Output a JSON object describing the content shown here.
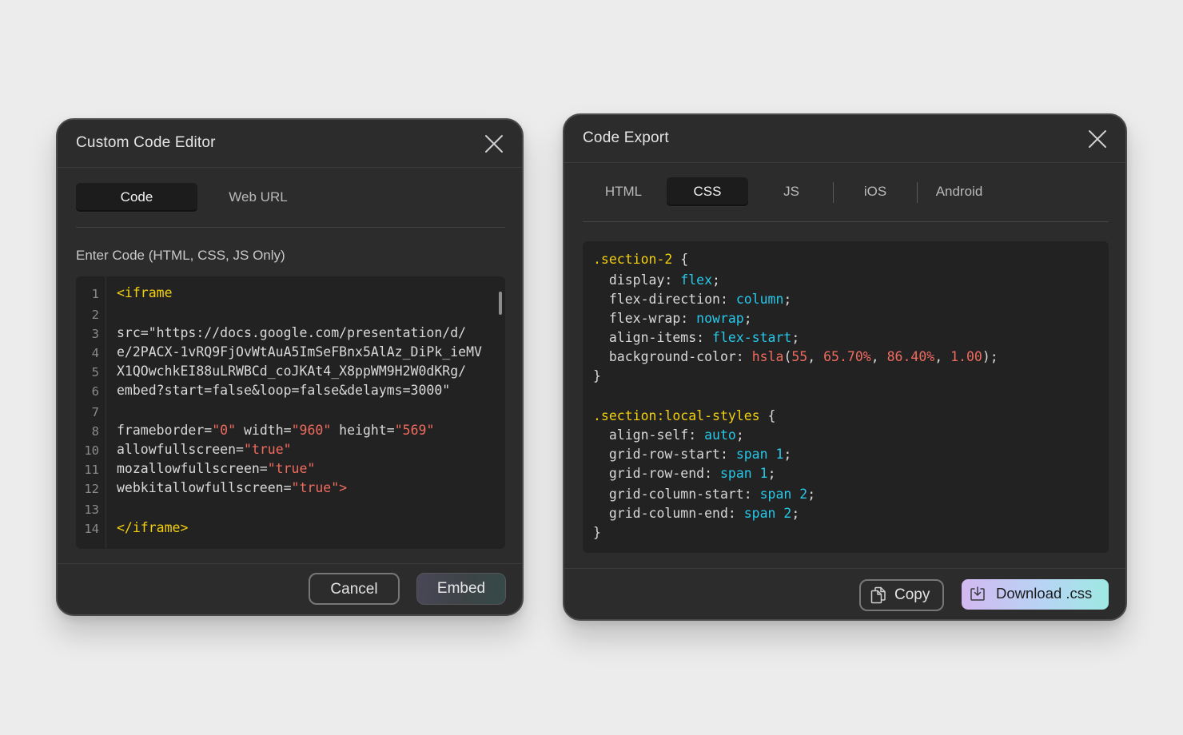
{
  "editor": {
    "title": "Custom Code Editor",
    "tabs": [
      {
        "label": "Code",
        "active": true
      },
      {
        "label": "Web URL",
        "active": false
      }
    ],
    "field_label": "Enter Code (HTML, CSS, JS Only)",
    "line_numbers": [
      "1",
      "2",
      "3",
      "4",
      "5",
      "6",
      "7",
      "8",
      "10",
      "11",
      "12",
      "13",
      "14"
    ],
    "code_lines": [
      {
        "tokens": [
          {
            "t": "<iframe",
            "c": "tag"
          }
        ]
      },
      {
        "tokens": []
      },
      {
        "tokens": [
          {
            "t": "src=\"https://docs.google.com/presentation/d/",
            "c": "txt"
          }
        ]
      },
      {
        "tokens": [
          {
            "t": "e/2PACX-1vRQ9FjOvWtAuA5ImSeFBnx5AlAz_DiPk_ieMV",
            "c": "txt"
          }
        ]
      },
      {
        "tokens": [
          {
            "t": "X1QOwchkEI88uLRWBCd_coJKAt4_X8ppWM9H2W0dKRg/",
            "c": "txt"
          }
        ]
      },
      {
        "tokens": [
          {
            "t": "embed?start=false&loop=false&delayms=3000\"",
            "c": "txt"
          }
        ]
      },
      {
        "tokens": []
      },
      {
        "tokens": [
          {
            "t": "frameborder=",
            "c": "txt"
          },
          {
            "t": "\"0\"",
            "c": "str"
          },
          {
            "t": " width=",
            "c": "txt"
          },
          {
            "t": "\"960\"",
            "c": "str"
          },
          {
            "t": " height=",
            "c": "txt"
          },
          {
            "t": "\"569\"",
            "c": "str"
          }
        ]
      },
      {
        "tokens": [
          {
            "t": "allowfullscreen=",
            "c": "txt"
          },
          {
            "t": "\"true\"",
            "c": "str"
          }
        ]
      },
      {
        "tokens": [
          {
            "t": "mozallowfullscreen=",
            "c": "txt"
          },
          {
            "t": "\"true\"",
            "c": "str"
          }
        ]
      },
      {
        "tokens": [
          {
            "t": "webkitallowfullscreen=",
            "c": "txt"
          },
          {
            "t": "\"true\">",
            "c": "str"
          }
        ]
      },
      {
        "tokens": []
      },
      {
        "tokens": [
          {
            "t": "</iframe>",
            "c": "tag"
          }
        ]
      }
    ],
    "cancel_label": "Cancel",
    "embed_label": "Embed"
  },
  "export": {
    "title": "Code Export",
    "tabs": [
      {
        "label": "HTML",
        "active": false
      },
      {
        "label": "CSS",
        "active": true
      },
      {
        "label": "JS",
        "active": false
      },
      {
        "label": "iOS",
        "active": false
      },
      {
        "label": "Android",
        "active": false
      }
    ],
    "code_lines": [
      {
        "tokens": [
          {
            "t": ".section-2",
            "c": "sel"
          },
          {
            "t": " {",
            "c": "txt"
          }
        ]
      },
      {
        "tokens": [
          {
            "t": "  display: ",
            "c": "txt"
          },
          {
            "t": "flex",
            "c": "val"
          },
          {
            "t": ";",
            "c": "txt"
          }
        ]
      },
      {
        "tokens": [
          {
            "t": "  flex-direction: ",
            "c": "txt"
          },
          {
            "t": "column",
            "c": "val"
          },
          {
            "t": ";",
            "c": "txt"
          }
        ]
      },
      {
        "tokens": [
          {
            "t": "  flex-wrap: ",
            "c": "txt"
          },
          {
            "t": "nowrap",
            "c": "val"
          },
          {
            "t": ";",
            "c": "txt"
          }
        ]
      },
      {
        "tokens": [
          {
            "t": "  align-items: ",
            "c": "txt"
          },
          {
            "t": "flex-start",
            "c": "val"
          },
          {
            "t": ";",
            "c": "txt"
          }
        ]
      },
      {
        "tokens": [
          {
            "t": "  background-color: ",
            "c": "txt"
          },
          {
            "t": "hsla",
            "c": "num"
          },
          {
            "t": "(",
            "c": "txt"
          },
          {
            "t": "55",
            "c": "num"
          },
          {
            "t": ", ",
            "c": "txt"
          },
          {
            "t": "65.70%",
            "c": "num"
          },
          {
            "t": ", ",
            "c": "txt"
          },
          {
            "t": "86.40%",
            "c": "num"
          },
          {
            "t": ", ",
            "c": "txt"
          },
          {
            "t": "1.00",
            "c": "num"
          },
          {
            "t": ");",
            "c": "txt"
          }
        ]
      },
      {
        "tokens": [
          {
            "t": "}",
            "c": "txt"
          }
        ]
      },
      {
        "tokens": []
      },
      {
        "tokens": [
          {
            "t": ".section:local-styles",
            "c": "sel"
          },
          {
            "t": " {",
            "c": "txt"
          }
        ]
      },
      {
        "tokens": [
          {
            "t": "  align-self: ",
            "c": "txt"
          },
          {
            "t": "auto",
            "c": "val"
          },
          {
            "t": ";",
            "c": "txt"
          }
        ]
      },
      {
        "tokens": [
          {
            "t": "  grid-row-start: ",
            "c": "txt"
          },
          {
            "t": "span 1",
            "c": "val"
          },
          {
            "t": ";",
            "c": "txt"
          }
        ]
      },
      {
        "tokens": [
          {
            "t": "  grid-row-end: ",
            "c": "txt"
          },
          {
            "t": "span 1",
            "c": "val"
          },
          {
            "t": ";",
            "c": "txt"
          }
        ]
      },
      {
        "tokens": [
          {
            "t": "  grid-column-start: ",
            "c": "txt"
          },
          {
            "t": "span 2",
            "c": "val"
          },
          {
            "t": ";",
            "c": "txt"
          }
        ]
      },
      {
        "tokens": [
          {
            "t": "  grid-column-end: ",
            "c": "txt"
          },
          {
            "t": "span 2",
            "c": "val"
          },
          {
            "t": ";",
            "c": "txt"
          }
        ]
      },
      {
        "tokens": [
          {
            "t": "}",
            "c": "txt"
          }
        ]
      }
    ],
    "copy_label": "Copy",
    "download_label": "Download .css"
  },
  "colors": {
    "selector": "#f2d00f",
    "value": "#27c8e8",
    "number": "#ef6b5e",
    "panel": "#2c2c2d",
    "code_bg": "#222223"
  },
  "icons": [
    "close-icon",
    "copy-icon",
    "download-icon"
  ]
}
